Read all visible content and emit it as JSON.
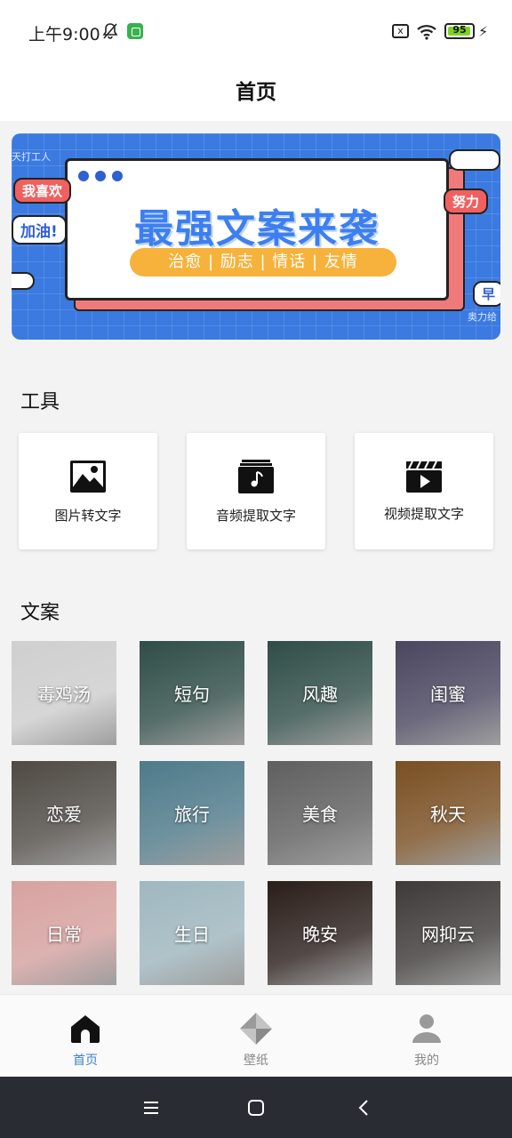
{
  "status_bar": {
    "time": "上午9:00",
    "battery": "95",
    "battery_level": 0.95,
    "sim_label": "x"
  },
  "header": {
    "title": "首页"
  },
  "banner": {
    "title": "最强文案来袭",
    "tags": "治愈 | 励志 | 情话 | 友情",
    "bubble_love": "我喜欢",
    "bubble_cheer": "加油!",
    "bubble_effort": "努力",
    "bubble_morning": "早",
    "corner_top": "天打工人",
    "corner_bottom": "奥力给"
  },
  "tools_section": {
    "title": "工具",
    "items": [
      {
        "label": "图片转文字",
        "icon": "image-icon"
      },
      {
        "label": "音频提取文字",
        "icon": "music-note-icon"
      },
      {
        "label": "视频提取文字",
        "icon": "video-clapper-icon"
      }
    ]
  },
  "copy_section": {
    "title": "文案",
    "categories": [
      {
        "label": "毒鸡汤",
        "bg": "#cfcfcf"
      },
      {
        "label": "短句",
        "bg": "#2f4d47"
      },
      {
        "label": "风趣",
        "bg": "#2f4d47"
      },
      {
        "label": "闺蜜",
        "bg": "#4a4660"
      },
      {
        "label": "恋爱",
        "bg": "#4f4a44"
      },
      {
        "label": "旅行",
        "bg": "#4e7a8a"
      },
      {
        "label": "美食",
        "bg": "#5f5f5f"
      },
      {
        "label": "秋天",
        "bg": "#7a4f22"
      },
      {
        "label": "日常",
        "bg": "#d7a2a0"
      },
      {
        "label": "生日",
        "bg": "#9fb7bf"
      },
      {
        "label": "晚安",
        "bg": "#2a1e1a"
      },
      {
        "label": "网抑云",
        "bg": "#3d3a38"
      }
    ]
  },
  "bottom_nav": {
    "items": [
      {
        "label": "首页",
        "icon": "home-icon",
        "active": true
      },
      {
        "label": "壁纸",
        "icon": "wallpaper-icon",
        "active": false
      },
      {
        "label": "我的",
        "icon": "profile-icon",
        "active": false
      }
    ]
  },
  "colors": {
    "accent": "#3b82c6",
    "banner_blue": "#3b7ae0",
    "banner_orange": "#f7b23b"
  }
}
